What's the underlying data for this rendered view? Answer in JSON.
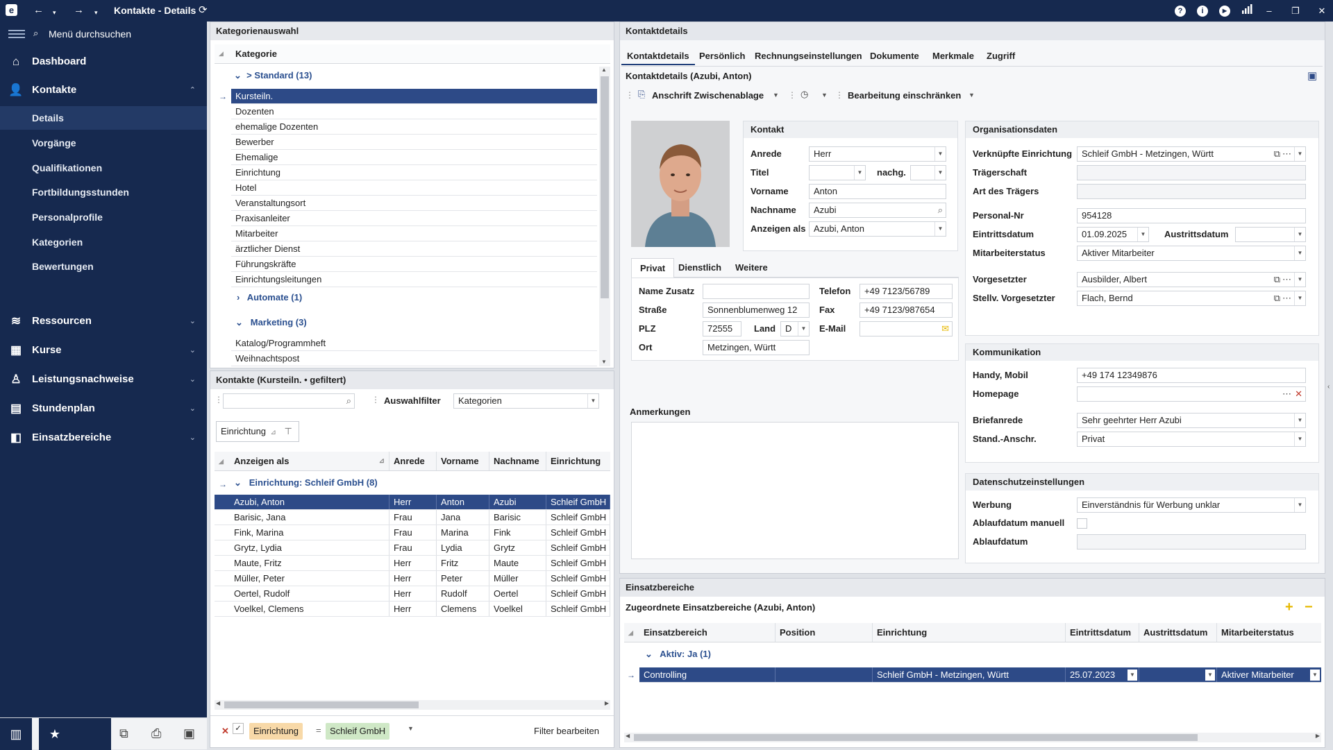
{
  "window": {
    "title": "Kontakte - Details",
    "logo": "e"
  },
  "sidebar": {
    "search_label": "Menü durchsuchen",
    "nav": [
      {
        "label": "Dashboard",
        "icon": "home-icon"
      },
      {
        "label": "Kontakte",
        "icon": "user-icon"
      },
      {
        "label": "Ressourcen",
        "icon": "database-icon"
      },
      {
        "label": "Kurse",
        "icon": "grid-icon"
      },
      {
        "label": "Leistungsnachweise",
        "icon": "certificate-icon"
      },
      {
        "label": "Stundenplan",
        "icon": "calendar-icon"
      },
      {
        "label": "Einsatzbereiche",
        "icon": "layout-icon"
      }
    ],
    "sub": [
      "Details",
      "Vorgänge",
      "Qualifikationen",
      "Fortbildungsstunden",
      "Personalprofile",
      "Kategorien",
      "Bewertungen"
    ]
  },
  "kategorien": {
    "title": "Kategorienauswahl",
    "column": "Kategorie",
    "group_standard": "> Standard (13)",
    "items": [
      "Kursteiln.",
      "Dozenten",
      "ehemalige Dozenten",
      "Bewerber",
      "Ehemalige",
      "Einrichtung",
      "Hotel",
      "Veranstaltungsort",
      "Praxisanleiter",
      "Mitarbeiter",
      "ärztlicher Dienst",
      "Führungskräfte",
      "Einrichtungsleitungen"
    ],
    "group_automate": "Automate (1)",
    "group_marketing": "Marketing (3)",
    "marketing_items": [
      "Katalog/Programmheft",
      "Weihnachtspost"
    ]
  },
  "kontakte": {
    "title": "Kontakte (Kursteiln. • gefiltert)",
    "search_placeholder": "",
    "filter_label": "Auswahlfilter",
    "filter_value": "Kategorien",
    "group_chip": "Einrichtung",
    "columns": [
      "Anzeigen als",
      "Anrede",
      "Vorname",
      "Nachname",
      "Einrichtung"
    ],
    "group_row": "Einrichtung: Schleif GmbH (8)",
    "rows": [
      [
        "Azubi, Anton",
        "Herr",
        "Anton",
        "Azubi",
        "Schleif GmbH"
      ],
      [
        "Barisic, Jana",
        "Frau",
        "Jana",
        "Barisic",
        "Schleif GmbH"
      ],
      [
        "Fink, Marina",
        "Frau",
        "Marina",
        "Fink",
        "Schleif GmbH"
      ],
      [
        "Grytz, Lydia",
        "Frau",
        "Lydia",
        "Grytz",
        "Schleif GmbH"
      ],
      [
        "Maute, Fritz",
        "Herr",
        "Fritz",
        "Maute",
        "Schleif GmbH"
      ],
      [
        "Müller, Peter",
        "Herr",
        "Peter",
        "Müller",
        "Schleif GmbH"
      ],
      [
        "Oertel, Rudolf",
        "Herr",
        "Rudolf",
        "Oertel",
        "Schleif GmbH"
      ],
      [
        "Voelkel, Clemens",
        "Herr",
        "Clemens",
        "Voelkel",
        "Schleif GmbH"
      ]
    ],
    "footer_filter_field": "Einrichtung",
    "footer_filter_eq": "=",
    "footer_filter_value": "Schleif GmbH",
    "footer_edit": "Filter bearbeiten"
  },
  "details": {
    "title": "Kontaktdetails",
    "tabs": [
      "Kontaktdetails",
      "Persönlich",
      "Rechnungseinstellungen",
      "Dokumente",
      "Merkmale",
      "Zugriff"
    ],
    "subtitle": "Kontaktdetails (Azubi, Anton)",
    "toolbar_copy": "Anschrift Zwischenablage",
    "toolbar_restrict": "Bearbeitung einschränken",
    "kontakt": {
      "title": "Kontakt",
      "anrede_label": "Anrede",
      "anrede": "Herr",
      "titel_label": "Titel",
      "titel": "",
      "nachg_label": "nachg.",
      "nachg": "",
      "vorname_label": "Vorname",
      "vorname": "Anton",
      "nachname_label": "Nachname",
      "nachname": "Azubi",
      "anzeigen_label": "Anzeigen als",
      "anzeigen": "Azubi, Anton"
    },
    "addr_tabs": [
      "Privat",
      "Dienstlich",
      "Weitere"
    ],
    "privat": {
      "namezusatz_label": "Name Zusatz",
      "namezusatz": "",
      "strasse_label": "Straße",
      "strasse": "Sonnenblumenweg 12",
      "plz_label": "PLZ",
      "plz": "72555",
      "land_label": "Land",
      "land": "D",
      "ort_label": "Ort",
      "ort": "Metzingen, Württ",
      "telefon_label": "Telefon",
      "telefon": "+49 7123/56789",
      "fax_label": "Fax",
      "fax": "+49 7123/987654",
      "email_label": "E-Mail",
      "email": ""
    },
    "anmerkungen": "Anmerkungen",
    "org": {
      "title": "Organisationsdaten",
      "einrichtung_label": "Verknüpfte Einrichtung",
      "einrichtung": "Schleif GmbH - Metzingen, Württ",
      "traeger_label": "Trägerschaft",
      "traeger": "",
      "art_label": "Art des Trägers",
      "art": "",
      "personalnr_label": "Personal-Nr",
      "personalnr": "954128",
      "eintritt_label": "Eintrittsdatum",
      "eintritt": "01.09.2025",
      "austritt_label": "Austrittsdatum",
      "austritt": "",
      "status_label": "Mitarbeiterstatus",
      "status": "Aktiver Mitarbeiter",
      "vorgesetzter_label": "Vorgesetzter",
      "vorgesetzter": "Ausbilder, Albert",
      "stellv_label": "Stellv. Vorgesetzter",
      "stellv": "Flach, Bernd"
    },
    "komm": {
      "title": "Kommunikation",
      "handy_label": "Handy, Mobil",
      "handy": "+49 174 12349876",
      "homepage_label": "Homepage",
      "homepage": "",
      "briefanrede_label": "Briefanrede",
      "briefanrede": "Sehr geehrter Herr Azubi",
      "standanschr_label": "Stand.-Anschr.",
      "standanschr": "Privat"
    },
    "datenschutz": {
      "title": "Datenschutzeinstellungen",
      "werbung_label": "Werbung",
      "werbung": "Einverständnis für Werbung unklar",
      "ablauf_manuell_label": "Ablaufdatum manuell",
      "ablauf_label": "Ablaufdatum",
      "ablauf": ""
    }
  },
  "einsatz": {
    "title": "Einsatzbereiche",
    "subtitle": "Zugeordnete Einsatzbereiche (Azubi, Anton)",
    "columns": [
      "Einsatzbereich",
      "Position",
      "Einrichtung",
      "Eintrittsdatum",
      "Austrittsdatum",
      "Mitarbeiterstatus"
    ],
    "group_row": "Aktiv: Ja (1)",
    "row": [
      "Controlling",
      "",
      "Schleif GmbH - Metzingen, Württ",
      "25.07.2023",
      "",
      "Aktiver Mitarbeiter"
    ]
  },
  "colors": {
    "navy": "#16294f",
    "selection": "#2d4a87",
    "accent_yellow": "#e6b800"
  }
}
